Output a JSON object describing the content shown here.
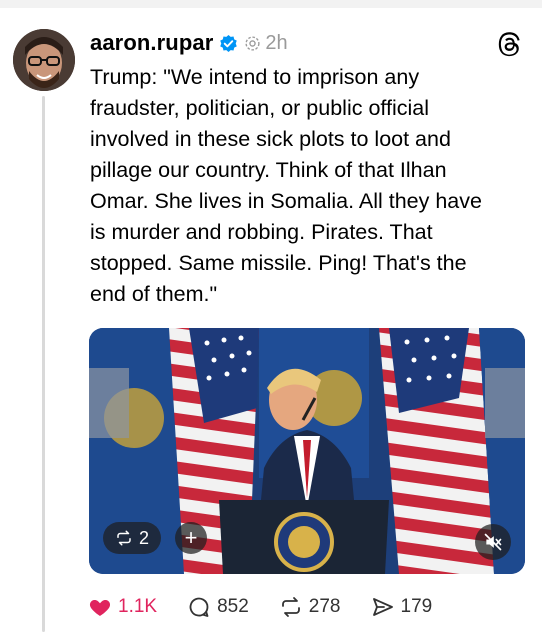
{
  "post": {
    "username": "aaron.rupar",
    "verified": true,
    "timestamp": "2h",
    "text": "Trump: \"We intend to imprison any\nfraudster, politician, or public official\ninvolved in these sick plots to loot and\npillage our country. Think of that Ilhan\nOmar. She lives in Somalia. All they have\nis murder and robbing. Pirates. That\nstopped. Same missile. Ping! That's the\nend of them.\""
  },
  "media": {
    "repost_count_label": "2",
    "plus_label": "+"
  },
  "actions": {
    "likes": "1.1K",
    "replies": "852",
    "reposts": "278",
    "shares": "179"
  },
  "colors": {
    "like_red": "#e0245e",
    "verified_blue": "#0095f6",
    "muted_gray": "#9a9a9a"
  },
  "icons": [
    "verified-icon",
    "dot-separator-icon",
    "threads-logo-icon",
    "repost-icon",
    "plus-icon",
    "mute-icon",
    "heart-icon",
    "reply-icon",
    "share-icon"
  ]
}
